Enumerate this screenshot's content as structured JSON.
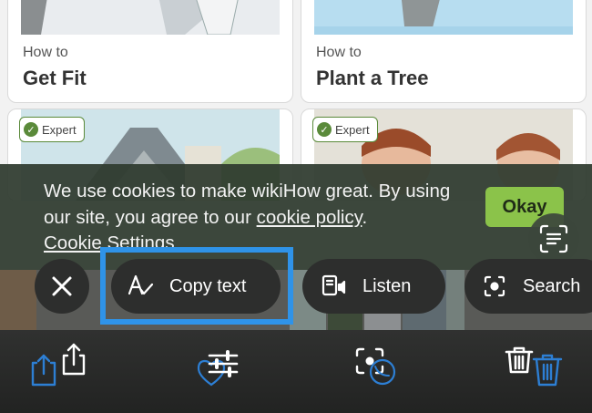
{
  "cards": [
    {
      "prefix": "How to",
      "title": "Get Fit"
    },
    {
      "prefix": "How to",
      "title": "Plant a Tree"
    },
    {
      "badge": "Expert"
    },
    {
      "badge": "Expert"
    }
  ],
  "cookie_banner": {
    "text_before": "We use cookies to make wikiHow great. By using our site, you agree to our ",
    "policy_link": "cookie policy",
    "text_after": ".",
    "settings_link": "Cookie Settings",
    "okay_label": "Okay"
  },
  "actions": {
    "copy_text_label": "Copy text",
    "listen_label": "Listen",
    "search_label": "Search"
  },
  "colors": {
    "highlight": "#2f93e8",
    "okay": "#8bc34a",
    "expert_badge": "#5a8a3a"
  },
  "icons": [
    "close-icon",
    "text-recognition-icon",
    "listen-icon",
    "visual-search-icon",
    "live-text-scan-icon",
    "share-icon",
    "adjust-icon",
    "visual-lookup-icon",
    "trash-icon"
  ]
}
